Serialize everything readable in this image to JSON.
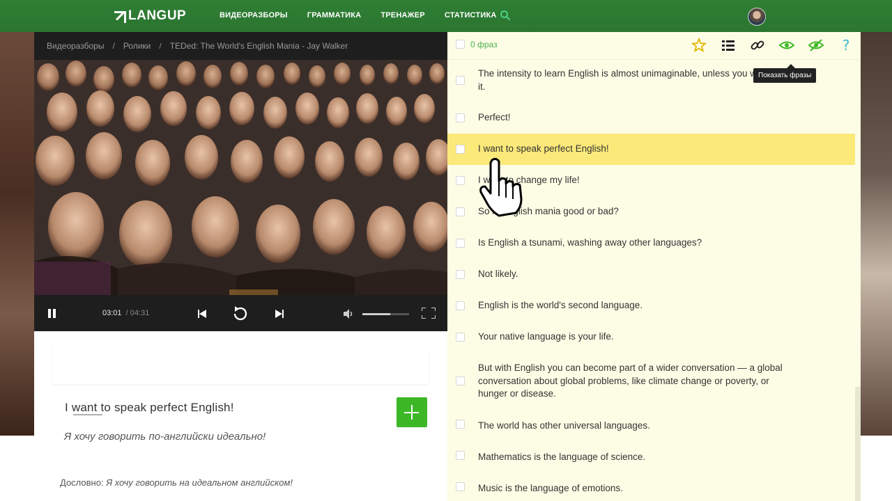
{
  "nav": {
    "logo": "LANGUP",
    "items": [
      "ВИДЕОРАЗБОРЫ",
      "ГРАММАТИКА",
      "ТРЕНАЖЕР",
      "СТАТИСТИКА"
    ]
  },
  "breadcrumb": [
    "Видеоразборы",
    "Ролики",
    "TEDed: The World's English Mania - Jay Walker"
  ],
  "player": {
    "current_time": "03:01",
    "separator": "/",
    "total_time": "04:31",
    "progress": 0.668,
    "volume": 0.6
  },
  "current_phrase": {
    "english": "I want to speak perfect English!",
    "russian": "Я хочу говорить по-английски идеально!",
    "literal_label": "Дословно:",
    "literal_value": "Я хочу говорить на идеальном английском!"
  },
  "phrase_panel": {
    "count_label": "0 фраз",
    "tooltip": "Показать фразы",
    "phrases": [
      {
        "text": "The intensity to learn English is almost unimaginable, unless you witness it.",
        "active": false
      },
      {
        "text": "Perfect!",
        "active": false
      },
      {
        "text": "I want to speak perfect English!",
        "active": true
      },
      {
        "text": "I want to change my life!",
        "active": false
      },
      {
        "text": "So is English mania good or bad?",
        "active": false
      },
      {
        "text": "Is English a tsunami, washing away other languages?",
        "active": false
      },
      {
        "text": "Not likely.",
        "active": false
      },
      {
        "text": "English is the world's second language.",
        "active": false
      },
      {
        "text": "Your native language is your life.",
        "active": false
      },
      {
        "text": "But with English you can become part of a wider conversation — a global conversation about global problems, like climate change or poverty, or hunger or disease.",
        "active": false
      },
      {
        "text": "The world has other universal languages.",
        "active": false
      },
      {
        "text": "Mathematics is the language of science.",
        "active": false
      },
      {
        "text": "Music is the language of emotions.",
        "active": false
      }
    ]
  },
  "colors": {
    "nav_green": "#2e7d32",
    "accent_green": "#3cb826",
    "highlight_yellow": "#fbe97a",
    "panel_bg": "#fdfde6"
  }
}
